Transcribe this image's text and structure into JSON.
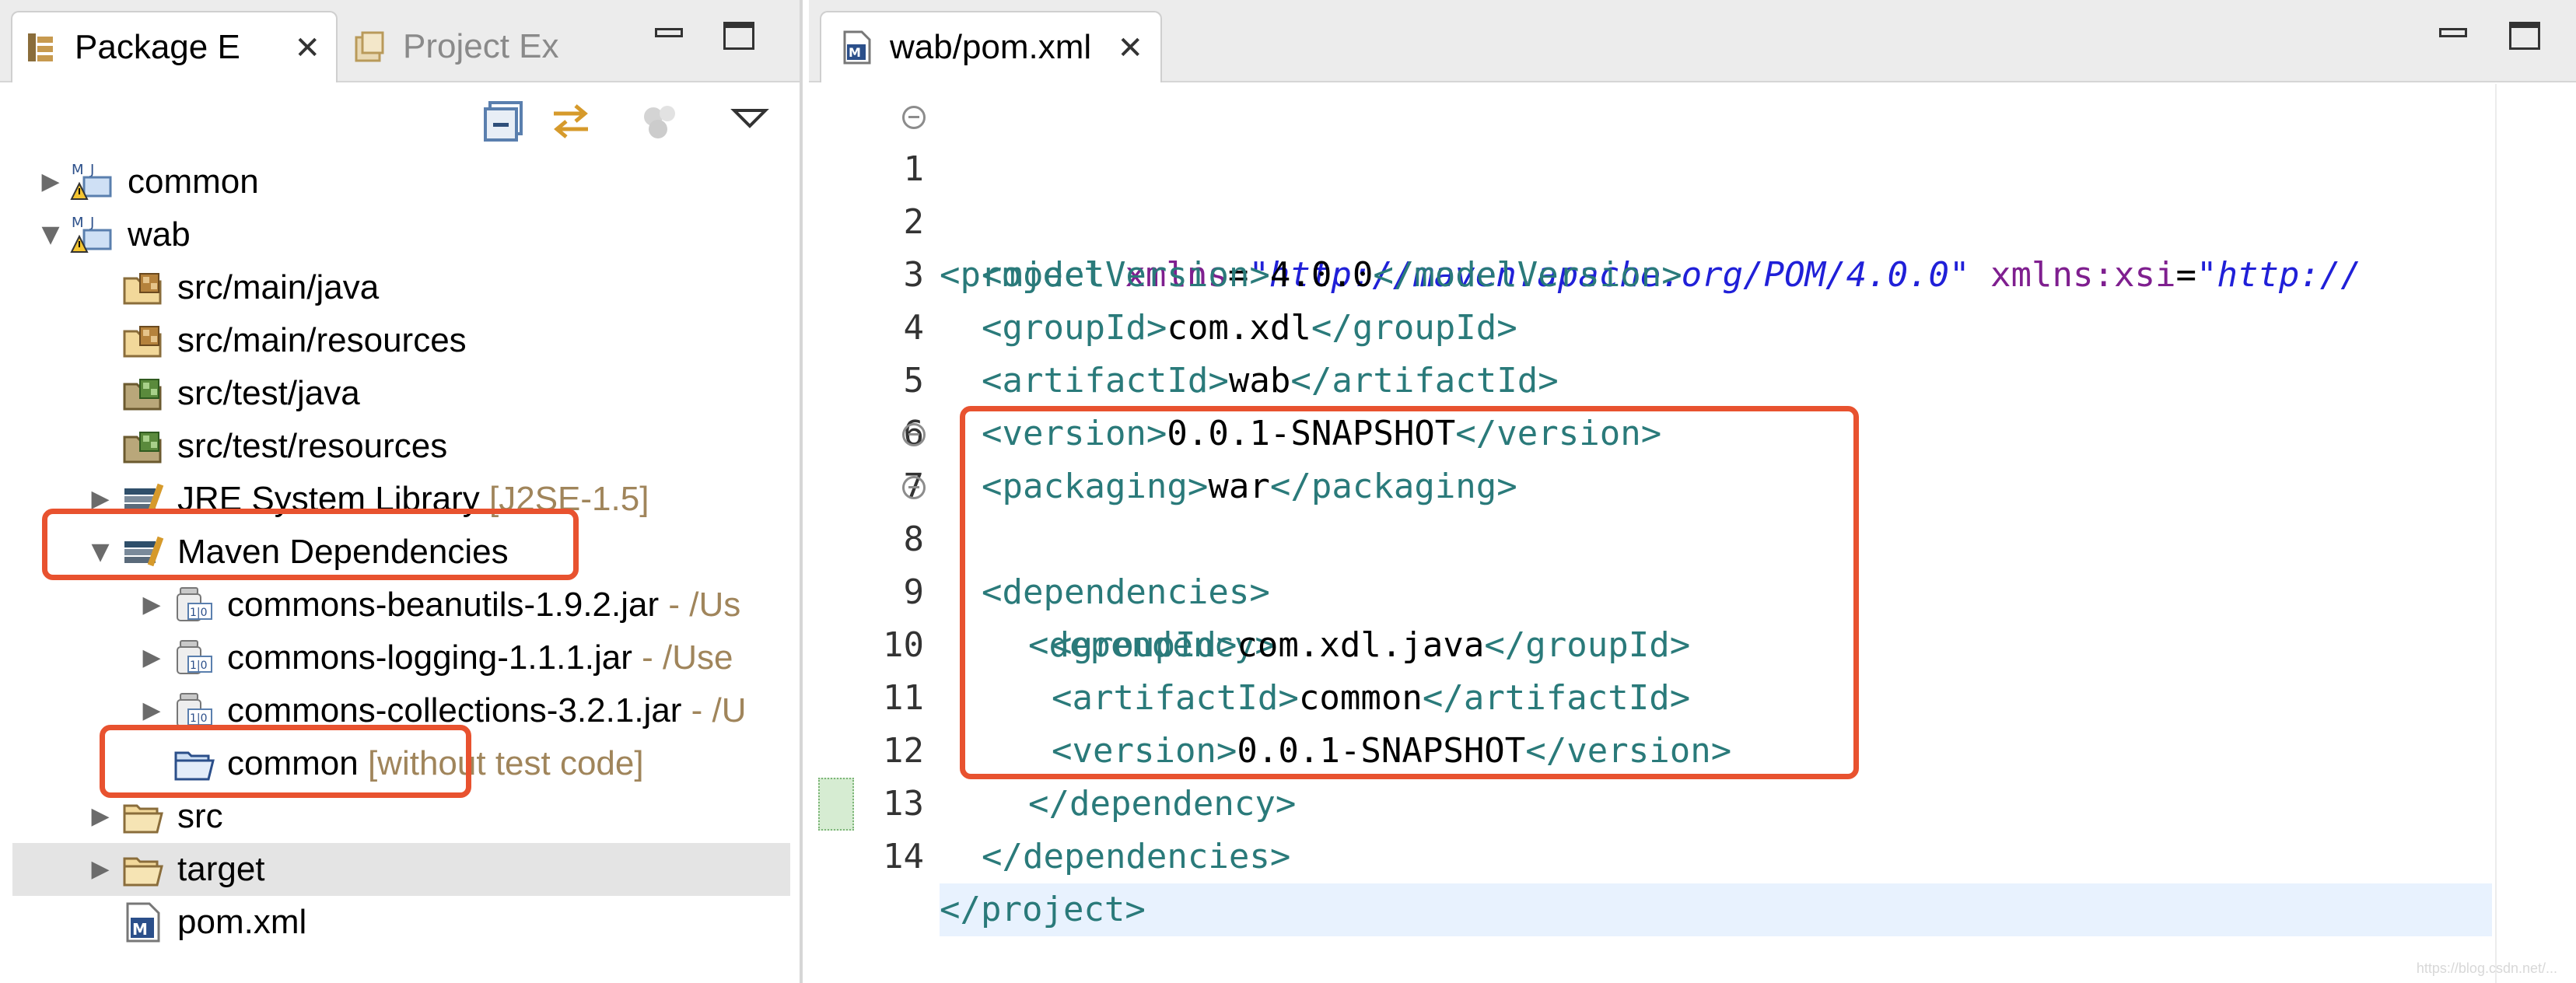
{
  "left_view": {
    "tabs": [
      {
        "label": "Package E",
        "active": true
      },
      {
        "label": "Project Ex",
        "active": false
      }
    ],
    "tree": [
      {
        "label": "common",
        "deco": ""
      },
      {
        "label": "wab",
        "deco": ""
      },
      {
        "label": "src/main/java",
        "deco": ""
      },
      {
        "label": "src/main/resources",
        "deco": ""
      },
      {
        "label": "src/test/java",
        "deco": ""
      },
      {
        "label": "src/test/resources",
        "deco": ""
      },
      {
        "label": "JRE System Library",
        "deco": "[J2SE-1.5]"
      },
      {
        "label": "Maven Dependencies",
        "deco": ""
      },
      {
        "label": "commons-beanutils-1.9.2.jar",
        "deco": " - /Us"
      },
      {
        "label": "commons-logging-1.1.1.jar",
        "deco": " - /Use"
      },
      {
        "label": "commons-collections-3.2.1.jar",
        "deco": " - /U"
      },
      {
        "label": "common",
        "deco": "[without test code]"
      },
      {
        "label": "src",
        "deco": ""
      },
      {
        "label": "target",
        "deco": ""
      },
      {
        "label": "pom.xml",
        "deco": ""
      }
    ]
  },
  "editor": {
    "tab_label": "wab/pom.xml",
    "lines": [
      {
        "n": "1"
      },
      {
        "n": "2"
      },
      {
        "n": "3"
      },
      {
        "n": "4"
      },
      {
        "n": "5"
      },
      {
        "n": "6"
      },
      {
        "n": "7"
      },
      {
        "n": "8"
      },
      {
        "n": "9"
      },
      {
        "n": "10"
      },
      {
        "n": "11"
      },
      {
        "n": "12"
      },
      {
        "n": "13"
      },
      {
        "n": "14"
      }
    ],
    "code": {
      "l1": {
        "open": "<project ",
        "attr1": "xmlns",
        "eq1": "=",
        "val1": "\"http://maven.apache.org/POM/4.0.0\"",
        "attr2": " xmlns:xsi",
        "eq2": "=",
        "val2": "\"http://"
      },
      "l2": {
        "open": "<modelVersion>",
        "text": "4.0.0",
        "close": "</modelVersion>"
      },
      "l3": {
        "open": "<groupId>",
        "text": "com.xdl",
        "close": "</groupId>"
      },
      "l4": {
        "open": "<artifactId>",
        "text": "wab",
        "close": "</artifactId>"
      },
      "l5": {
        "open": "<version>",
        "text": "0.0.1-SNAPSHOT",
        "close": "</version>"
      },
      "l6": {
        "open": "<packaging>",
        "text": "war",
        "close": "</packaging>"
      },
      "l7": {
        "open": "<dependencies>"
      },
      "l8": {
        "open": "<dependency>"
      },
      "l9": {
        "open": "<groupId>",
        "text": "com.xdl.java",
        "close": "</groupId>"
      },
      "l10": {
        "open": "<artifactId>",
        "text": "common",
        "close": "</artifactId>"
      },
      "l11": {
        "open": "<version>",
        "text": "0.0.1-SNAPSHOT",
        "close": "</version>"
      },
      "l12": {
        "close": "</dependency>"
      },
      "l13": {
        "close": "</dependencies>"
      },
      "l14": {
        "close": "</project>"
      }
    }
  },
  "watermark": "https://blog.csdn.net/..."
}
